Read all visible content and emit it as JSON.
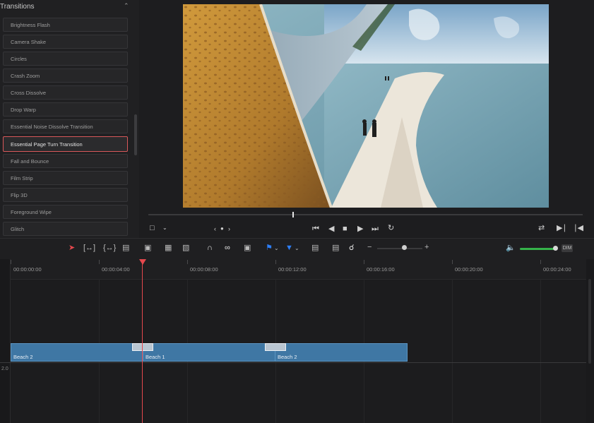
{
  "panel": {
    "title": "Transitions",
    "items": [
      "Brightness Flash",
      "Camera Shake",
      "Circles",
      "Crash Zoom",
      "Cross Dissolve",
      "Drop Warp",
      "Essential Noise Dissolve Transition",
      "Essential Page Turn Transition",
      "Fall and Bounce",
      "Film Strip",
      "Flip 3D",
      "Foreground Wipe",
      "Glitch"
    ],
    "selected_index": 7
  },
  "timeline": {
    "timecodes": [
      "00:00:00:00",
      "00:00:04:00",
      "00:00:08:00",
      "00:00:12:00",
      "00:00:16:00",
      "00:00:20:00",
      "00:00:24:00"
    ],
    "track_number": "2.0",
    "clips": [
      {
        "label": "Beach 2"
      },
      {
        "label": "Beach 1"
      },
      {
        "label": "Beach 2"
      }
    ]
  },
  "toolbar": {
    "dim_label": "DIM"
  },
  "colors": {
    "accent_selection": "#d8585a",
    "playhead": "#e5484d",
    "clip": "#3f77a4",
    "volume": "#35b34a",
    "flag_blue": "#2d7ff9"
  }
}
